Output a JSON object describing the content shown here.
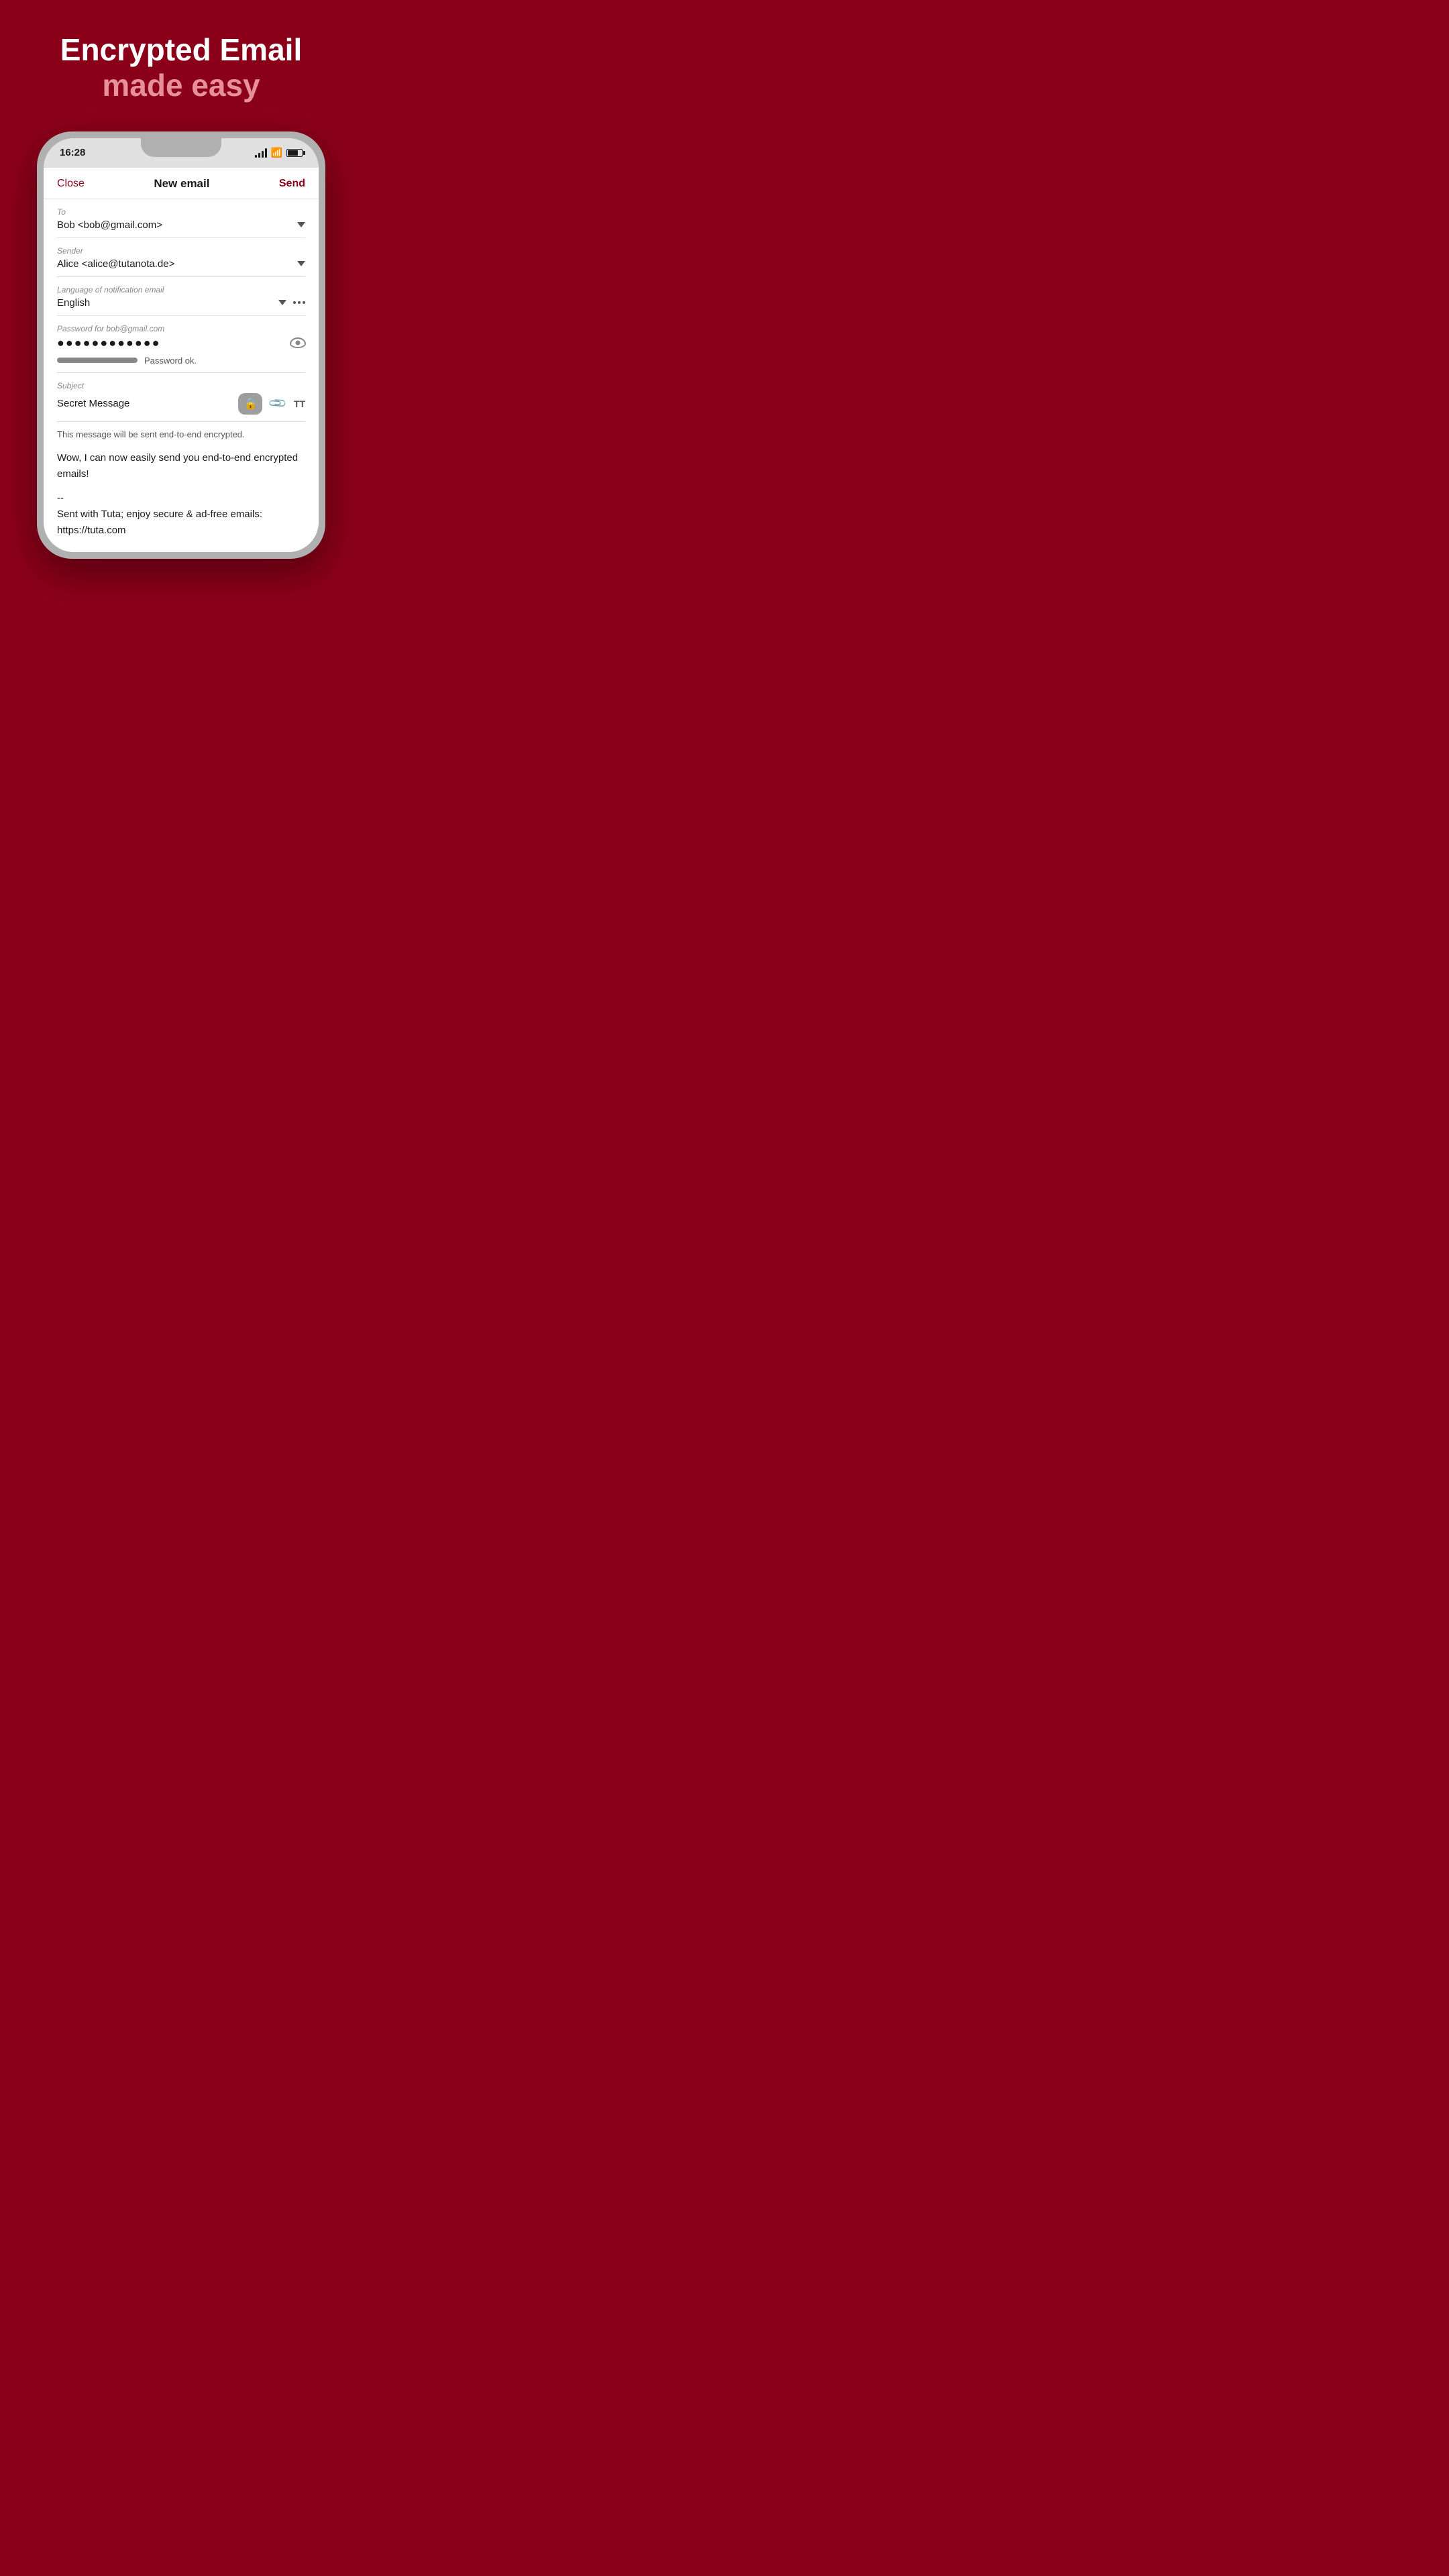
{
  "hero": {
    "title": "Encrypted Email",
    "subtitle": "made easy"
  },
  "status_bar": {
    "time": "16:28",
    "battery_pct": 75
  },
  "email_header": {
    "close_label": "Close",
    "title": "New email",
    "send_label": "Send"
  },
  "fields": {
    "to": {
      "label": "To",
      "value": "Bob <bob@gmail.com>"
    },
    "sender": {
      "label": "Sender",
      "value": "Alice <alice@tutanota.de>"
    },
    "language": {
      "label": "Language of notification email",
      "value": "English"
    },
    "password": {
      "label": "Password for bob@gmail.com",
      "value": "●●●●●●●●●●●●",
      "strength_label": "Password ok."
    },
    "subject": {
      "label": "Subject",
      "value": "Secret Message"
    }
  },
  "email_body": {
    "encryption_notice": "This message will be sent end-to-end encrypted.",
    "message": "Wow, I can now easily send you end-to-end encrypted emails!",
    "signature_separator": "--",
    "signature": "Sent with Tuta; enjoy secure & ad-free emails: https://tuta.com"
  },
  "colors": {
    "brand": "#8B0019",
    "accent": "#e8909a",
    "background": "#8B0019"
  }
}
